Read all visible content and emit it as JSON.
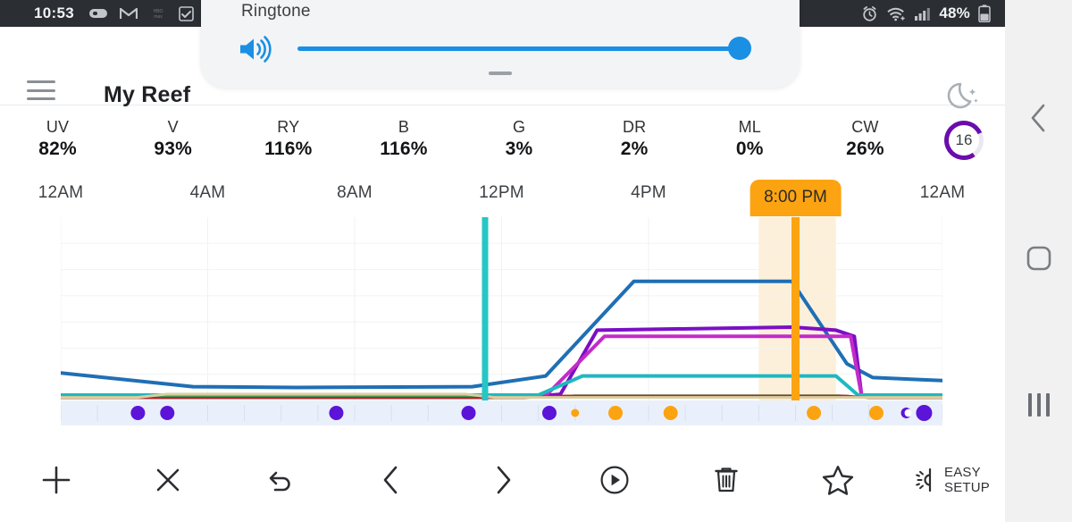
{
  "statusbar": {
    "clock": "10:53",
    "battery_text": "48%",
    "icons": [
      "capsule-icon",
      "gmail-icon",
      "hbomax-icon",
      "checkbox-icon",
      "alarm-icon",
      "wifi-icon",
      "signal-icon",
      "battery-icon"
    ]
  },
  "volume_panel": {
    "label": "Ringtone",
    "level_percent": 100,
    "speaker_icon": "speaker-loud-icon",
    "accent": "#1a8fe3"
  },
  "appbar": {
    "menu_icon": "hamburger-menu-icon",
    "title": "My Reef",
    "night_icon": "moon-stars-icon"
  },
  "channels": [
    {
      "name": "UV",
      "value": "82%"
    },
    {
      "name": "V",
      "value": "93%"
    },
    {
      "name": "RY",
      "value": "116%"
    },
    {
      "name": "B",
      "value": "116%"
    },
    {
      "name": "G",
      "value": "3%"
    },
    {
      "name": "DR",
      "value": "2%"
    },
    {
      "name": "ML",
      "value": "0%"
    },
    {
      "name": "CW",
      "value": "26%"
    }
  ],
  "ring": {
    "value": "16",
    "percent": 78,
    "color": "#6A0DAD",
    "track": "#ece8f2"
  },
  "cursor": {
    "label": "8:00 PM",
    "color": "#FCA311",
    "highlight": "#FDF0DA"
  },
  "toolbar": [
    {
      "icon": "plus-icon",
      "label": ""
    },
    {
      "icon": "close-x-icon",
      "label": ""
    },
    {
      "icon": "undo-icon",
      "label": ""
    },
    {
      "icon": "chevron-left-icon",
      "label": ""
    },
    {
      "icon": "chevron-right-icon",
      "label": ""
    },
    {
      "icon": "play-circle-icon",
      "label": ""
    },
    {
      "icon": "trash-icon",
      "label": ""
    },
    {
      "icon": "star-icon",
      "label": ""
    },
    {
      "icon": "easy-setup-icon",
      "label": "EASY\nSETUP",
      "label_line1": "EASY",
      "label_line2": "SETUP"
    }
  ],
  "navbar": {
    "back": "back-chevron-icon",
    "home": "home-square-icon",
    "recents": "recents-bars-icon"
  },
  "chart_data": {
    "type": "line",
    "title": "",
    "xlabel": "",
    "ylabel": "",
    "xlim": [
      0,
      24
    ],
    "ylim": [
      0,
      120
    ],
    "grid": true,
    "legend_position": "none",
    "tick_labels": [
      "12AM",
      "4AM",
      "8AM",
      "12PM",
      "4PM",
      "8PM",
      "12AM"
    ],
    "tick_hours": [
      0,
      4,
      8,
      12,
      16,
      20,
      24
    ],
    "visible_tick_labels": [
      {
        "label": "12AM",
        "hour": 0
      },
      {
        "label": "4AM",
        "hour": 4
      },
      {
        "label": "8AM",
        "hour": 8
      },
      {
        "label": "12PM",
        "hour": 12
      },
      {
        "label": "4PM",
        "hour": 16
      },
      {
        "label": "12AM",
        "hour": 24
      }
    ],
    "cursor_hour": 20,
    "cursor_label": "8:00 PM",
    "highlight_band": {
      "start_hour": 19.0,
      "end_hour": 21.1
    },
    "now_marker": {
      "hour": 11.55,
      "color": "#26C6C6"
    },
    "series": [
      {
        "name": "B",
        "color": "#1f6fb4",
        "width": 4,
        "x": [
          0,
          3.6,
          6.4,
          11.2,
          13.2,
          15.6,
          16.6,
          19.9,
          21.4,
          22.1,
          24
        ],
        "y": [
          18,
          9,
          8.5,
          9,
          16,
          78,
          78,
          78,
          24,
          15,
          13
        ]
      },
      {
        "name": "UV",
        "color": "#7B0FC4",
        "width": 4,
        "x": [
          0,
          13.1,
          13.6,
          14.6,
          19.9,
          21.1,
          21.6,
          21.8,
          24
        ],
        "y": [
          3,
          3,
          4,
          46,
          48,
          46,
          42,
          3,
          3
        ]
      },
      {
        "name": "V",
        "color": "#C32BC8",
        "width": 4,
        "x": [
          0,
          13.2,
          14.8,
          19.9,
          21.5,
          21.8,
          24
        ],
        "y": [
          3,
          3,
          42,
          42,
          42,
          3,
          3
        ]
      },
      {
        "name": "CW",
        "color": "#1FB8C0",
        "width": 4,
        "x": [
          0,
          13.0,
          14.2,
          19.9,
          21.1,
          21.7,
          24
        ],
        "y": [
          3.5,
          3.5,
          16,
          16,
          16,
          3.5,
          3.5
        ]
      },
      {
        "name": "G",
        "color": "#3AA05A",
        "width": 2.5,
        "x": [
          0,
          13.2,
          14.0,
          21.2,
          21.8,
          24
        ],
        "y": [
          2.2,
          2.2,
          3.2,
          3.2,
          2.2,
          2.2
        ]
      },
      {
        "name": "DR",
        "color": "#B8252B",
        "width": 2.5,
        "x": [
          0,
          12.6,
          13.6,
          21.4,
          22.0,
          24
        ],
        "y": [
          1.6,
          1.6,
          3.0,
          3.0,
          1.6,
          1.6
        ]
      },
      {
        "name": "ML",
        "color": "#D9CFA0",
        "width": 3,
        "x": [
          0,
          2.1,
          2.9,
          11.0,
          11.8,
          24
        ],
        "y": [
          2.0,
          2.0,
          4.2,
          4.2,
          2.0,
          2.0
        ]
      }
    ],
    "events": [
      {
        "hour": 2.1,
        "color": "#5B14D8",
        "r": 8,
        "kind": "moon-event"
      },
      {
        "hour": 2.9,
        "color": "#5B14D8",
        "r": 8,
        "kind": "moon-event"
      },
      {
        "hour": 7.5,
        "color": "#5B14D8",
        "r": 8,
        "kind": "moon-event"
      },
      {
        "hour": 11.1,
        "color": "#5B14D8",
        "r": 8,
        "kind": "moon-event"
      },
      {
        "hour": 13.3,
        "color": "#5B14D8",
        "r": 8,
        "kind": "moon-event"
      },
      {
        "hour": 14.0,
        "color": "#FCA311",
        "r": 4.5,
        "kind": "sun-event-small"
      },
      {
        "hour": 15.1,
        "color": "#FCA311",
        "r": 8,
        "kind": "sun-event"
      },
      {
        "hour": 16.6,
        "color": "#FCA311",
        "r": 8,
        "kind": "sun-event"
      },
      {
        "hour": 20.5,
        "color": "#FCA311",
        "r": 8,
        "kind": "sun-event"
      },
      {
        "hour": 22.2,
        "color": "#FCA311",
        "r": 8,
        "kind": "sun-event"
      },
      {
        "hour": 23.0,
        "color": "#5B14D8",
        "r": 6,
        "kind": "moon-crescent"
      },
      {
        "hour": 23.5,
        "color": "#5B14D8",
        "r": 9,
        "kind": "moon-event"
      }
    ]
  }
}
